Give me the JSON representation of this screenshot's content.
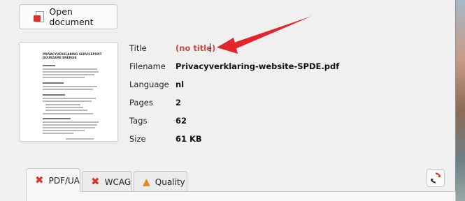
{
  "toolbar": {
    "open_label": "Open document",
    "open_icon": "pdf-file-icon"
  },
  "thumbnail": {
    "title_lines": [
      "PRIVACYVERKLARING SERVICEPUNT",
      "DUURZAME ENERGIE"
    ],
    "signature": "Privacyverklaring website SPDE"
  },
  "properties": [
    {
      "label": "Title",
      "value": "(no title)",
      "missing": true
    },
    {
      "label": "Filename",
      "value": "Privacyverklaring-website-SPDE.pdf"
    },
    {
      "label": "Language",
      "value": "nl"
    },
    {
      "label": "Pages",
      "value": "2"
    },
    {
      "label": "Tags",
      "value": "62"
    },
    {
      "label": "Size",
      "value": "61 KB"
    }
  ],
  "tabs": [
    {
      "label": "PDF/UA",
      "icon": "x-icon",
      "status": "fail",
      "active": true
    },
    {
      "label": "WCAG",
      "icon": "x-icon",
      "status": "fail",
      "active": false
    },
    {
      "label": "Quality",
      "icon": "warning-icon",
      "status": "warning",
      "active": false
    }
  ],
  "refresh_icon": "refresh-icon",
  "colors": {
    "missing": "#c74b3f",
    "fail": "#d9362b",
    "warning": "#e08a1e",
    "arrow": "#e2242b"
  }
}
